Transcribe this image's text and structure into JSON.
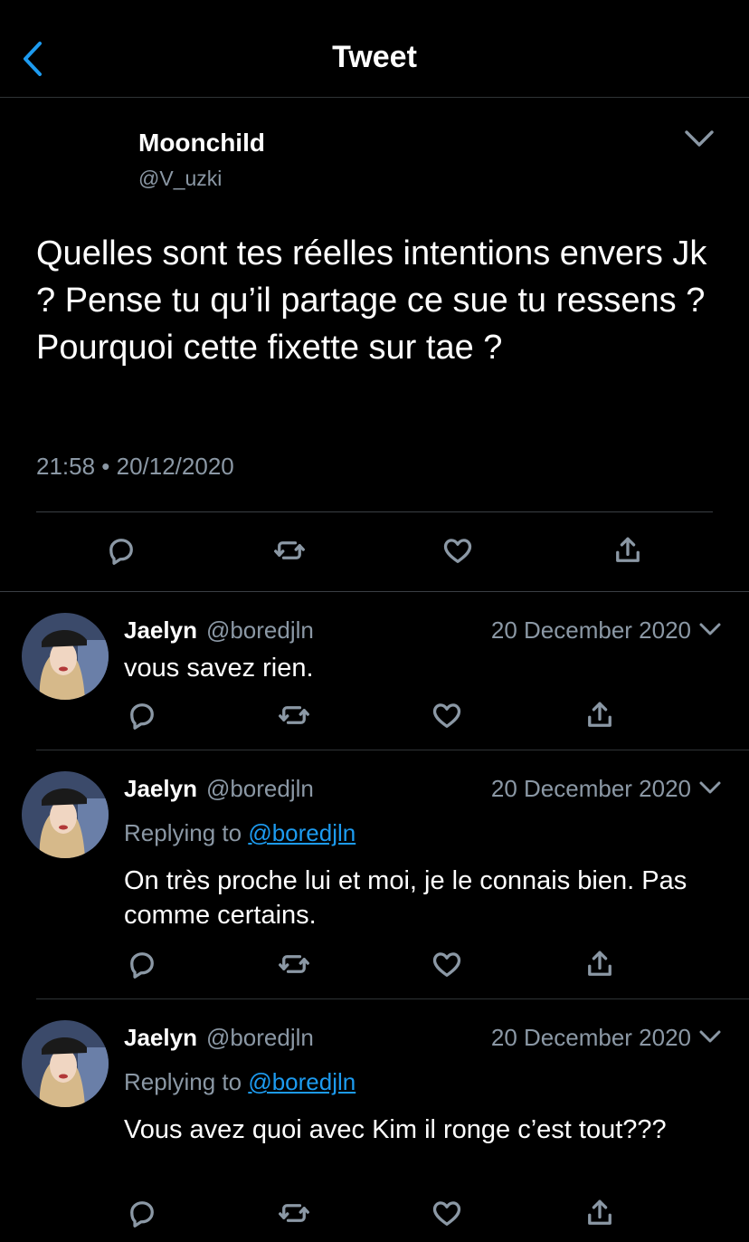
{
  "header": {
    "title": "Tweet"
  },
  "main_tweet": {
    "name": "Moonchild",
    "handle": "@V_uzki",
    "text": "Quelles sont tes réelles intentions envers Jk ? Pense tu qu’il partage ce sue tu ressens ? Pourquoi cette fixette sur tae ?",
    "timestamp": "21:58 • 20/12/2020"
  },
  "replies": [
    {
      "name": "Jaelyn",
      "handle": "@boredjln",
      "date": "20 December 2020",
      "replying_prefix": "",
      "replying_handle": "",
      "text": "vous savez rien."
    },
    {
      "name": "Jaelyn",
      "handle": "@boredjln",
      "date": "20 December 2020",
      "replying_prefix": "Replying to",
      "replying_handle": "@boredjln",
      "text": "On très proche lui et moi, je le connais bien. Pas comme certains."
    },
    {
      "name": "Jaelyn",
      "handle": "@boredjln",
      "date": "20 December 2020",
      "replying_prefix": "Replying to",
      "replying_handle": "@boredjln",
      "text": "Vous avez quoi avec Kim il ronge c’est tout???"
    }
  ],
  "icons": {
    "back": "chevron-left-icon",
    "more": "chevron-down-icon",
    "reply": "comment-icon",
    "retweet": "retweet-icon",
    "like": "heart-icon",
    "share": "share-icon"
  },
  "colors": {
    "background": "#000000",
    "text": "#ffffff",
    "secondary": "#8b98a5",
    "accent": "#1d9bf0",
    "divider": "#2f3336"
  }
}
